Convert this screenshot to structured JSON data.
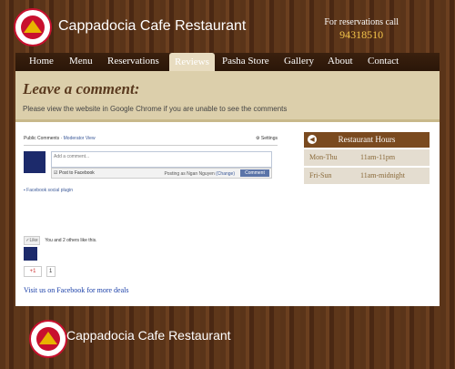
{
  "header": {
    "brand": "Cappadocia Cafe Restaurant",
    "reserve_label": "For reservations call",
    "phone": "94318510"
  },
  "nav": {
    "items": [
      "Home",
      "Menu",
      "Reservations",
      "Reviews",
      "Pasha Store",
      "Gallery",
      "About",
      "Contact"
    ],
    "active": "Reviews"
  },
  "banner": {
    "title": "Leave a comment:",
    "note": "Please view the website in Google Chrome if you are unable to see the comments"
  },
  "comments": {
    "header_label": "Public Comments",
    "moderator": "Moderator View",
    "settings": "Settings",
    "placeholder": "Add a comment...",
    "post_to_fb": "Post to Facebook",
    "posting_as": "Posting as Ngan Nguyen",
    "change": "(Change)",
    "comment_button": "Comment",
    "plugin": "Facebook social plugin"
  },
  "like": {
    "button": "Like",
    "text": "You and 2 others like this."
  },
  "gplus": {
    "button": "+1",
    "count": "1"
  },
  "facebook_link": "Visit us on Facebook for more deals",
  "hours": {
    "title": "Restaurant Hours",
    "rows": [
      {
        "day": "Mon-Thu",
        "time": "11am-11pm"
      },
      {
        "day": "Fri-Sun",
        "time": "11am-midnight"
      }
    ]
  },
  "footer": {
    "brand": "Cappadocia Cafe Restaurant"
  },
  "colors": {
    "accent": "#7a4a1f",
    "banner": "#dccfab",
    "link": "#1a3fa8"
  }
}
